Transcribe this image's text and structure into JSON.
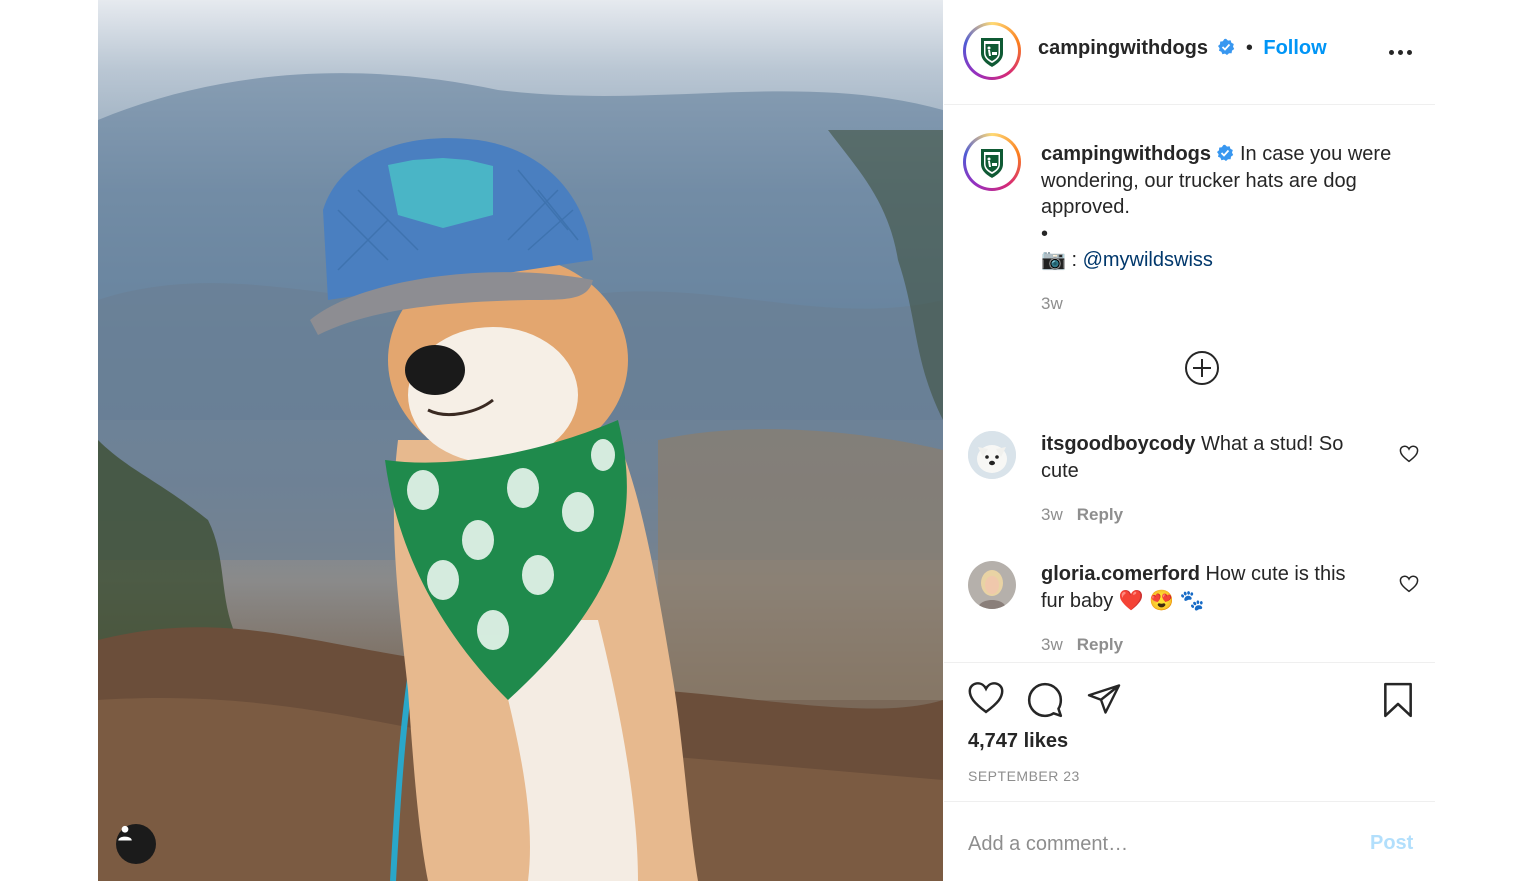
{
  "post": {
    "image_alt": "Shiba Inu dog wearing a blue trucker hat and green bandana on a mountain overlook",
    "tagged_user_icon": "user-icon"
  },
  "header": {
    "username": "campingwithdogs",
    "separator": "•",
    "follow_label": "Follow",
    "more_icon": "more-options-icon",
    "verified_icon": "verified-badge-icon"
  },
  "caption": {
    "username": "campingwithdogs",
    "text": "In case you were wondering, our trucker hats are dog approved.",
    "bullet": "•",
    "camera": "📷 : ",
    "mention": "@mywildswiss",
    "time": "3w"
  },
  "load_more_icon": "plus-circle-icon",
  "comments": [
    {
      "username": "itsgoodboycody",
      "text": "What a stud! So cute",
      "time": "3w",
      "reply_label": "Reply"
    },
    {
      "username": "gloria.comerford",
      "text": "How cute is this fur baby ❤️ 😍 🐾",
      "time": "3w",
      "reply_label": "Reply"
    }
  ],
  "actions": {
    "like_icon": "heart-icon",
    "comment_icon": "comment-icon",
    "share_icon": "send-icon",
    "save_icon": "bookmark-icon",
    "likes": "4,747 likes",
    "date": "SEPTEMBER 23"
  },
  "comment_box": {
    "placeholder": "Add a comment…",
    "post_label": "Post"
  },
  "colors": {
    "accent": "#0095f6",
    "mention": "#00376b",
    "muted": "#8e8e8e",
    "post_disabled": "#b2dffc",
    "bandana": "#1f8a4c",
    "hat": "#4a7fc0"
  }
}
